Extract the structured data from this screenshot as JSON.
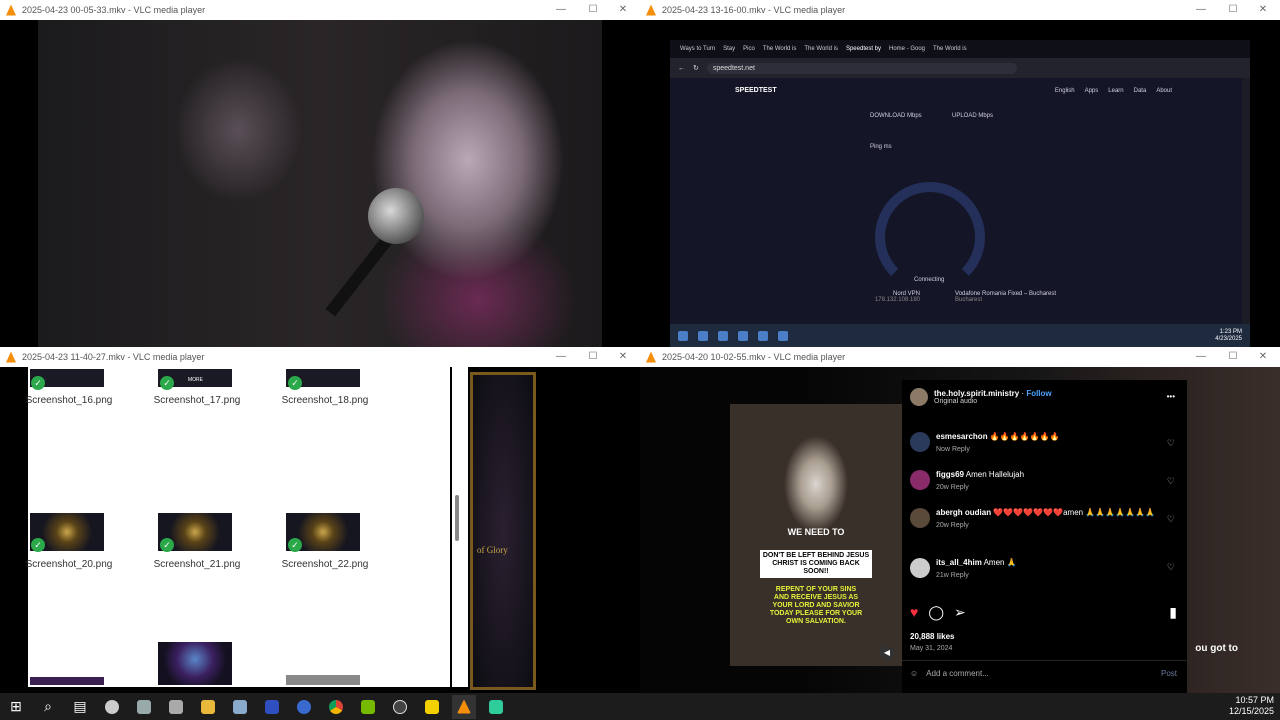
{
  "windows": {
    "w1": {
      "title": "2025-04-23 00-05-33.mkv - VLC media player"
    },
    "w2": {
      "title": "2025-04-23 13-16-00.mkv - VLC media player",
      "tabs": [
        "Ways to Turn",
        "Stay",
        "Pico",
        "The World is",
        "The World is",
        "Speedtest by",
        "Home - Goog",
        "The World is"
      ],
      "url": "speedtest.net",
      "speedtest": {
        "brand": "SPEEDTEST",
        "nav": [
          "English",
          "Apps",
          "Learn",
          "Data",
          "About"
        ],
        "download": "DOWNLOAD Mbps",
        "upload": "UPLOAD Mbps",
        "ping": "Ping ms",
        "connecting": "Connecting",
        "vpn": "Nord VPN",
        "ip": "178.132.108.180",
        "isp": "Vodafone Romania Fixed – Bucharest",
        "city": "Bucharest"
      },
      "clock_time": "1:23 PM",
      "clock_date": "4/23/2025"
    },
    "w3": {
      "title": "2025-04-23 11-40-27.mkv - VLC media player",
      "files": [
        "Screenshot_16.png",
        "Screenshot_17.png",
        "Screenshot_18.png",
        "Screenshot_20.png",
        "Screenshot_21.png",
        "Screenshot_22.png"
      ],
      "more_label": "MORE",
      "frame_text": "of Glory"
    },
    "w4": {
      "title": "2025-04-20 10-02-55.mkv - VLC media player",
      "reel": {
        "line1": "WE NEED TO",
        "line2": "DON'T BE LEFT BEHIND JESUS CHRIST IS COMING BACK SOON!!",
        "line3": "REPENT OF YOUR SINS AND RECEIVE JESUS AS YOUR LORD AND SAVIOR TODAY PLEASE FOR YOUR OWN SALVATION."
      },
      "ig": {
        "account": "the.holy.spirit.ministry",
        "follow": "Follow",
        "audio": "Original audio",
        "comments": [
          {
            "user": "esmesarchon",
            "text": "🔥🔥🔥🔥🔥🔥🔥",
            "time": "Now",
            "reply": "Reply"
          },
          {
            "user": "figgs69",
            "text": "Amen Hallelujah",
            "time": "20w",
            "reply": "Reply"
          },
          {
            "user": "abergh oudian",
            "text": "❤️❤️❤️❤️❤️❤️❤️amen 🙏🙏🙏🙏🙏🙏🙏",
            "time": "20w",
            "reply": "Reply"
          },
          {
            "user": "its_all_4him",
            "text": "Amen 🙏",
            "time": "21w",
            "reply": "Reply"
          }
        ],
        "likes": "20,888 likes",
        "date": "May 31, 2024",
        "add_comment": "Add a comment...",
        "post": "Post"
      },
      "side_text": "ou got to"
    }
  },
  "taskbar": {
    "time": "10:57 PM",
    "date": "12/15/2025"
  },
  "colors": {
    "vlc_orange": "#f58e0a",
    "ig_like": "#ff3040",
    "speedtest_bg": "#141526"
  }
}
